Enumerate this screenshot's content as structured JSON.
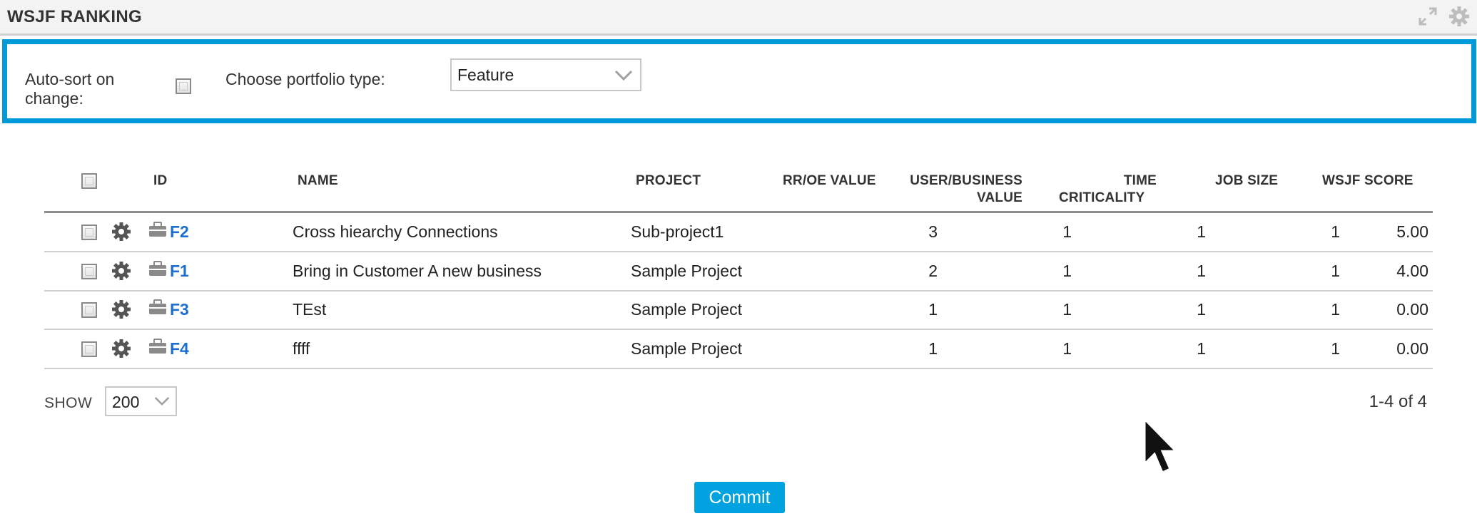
{
  "header": {
    "title": "WSJF RANKING",
    "icons": [
      "expand-icon",
      "gear-icon"
    ]
  },
  "filters": {
    "autosort_label": "Auto-sort on change:",
    "autosort_checked": false,
    "portfolio_label": "Choose portfolio type:",
    "portfolio_value": "Feature"
  },
  "table": {
    "columns": {
      "id": "ID",
      "name": "NAME",
      "project": "PROJECT",
      "rroe": "RR/OE VALUE",
      "ubv1": "USER/BUSINESS",
      "ubv2": "VALUE",
      "tc1": "TIME",
      "tc2": "CRITICALITY",
      "job_size": "JOB SIZE",
      "wsjf": "WSJF SCORE"
    },
    "rows": [
      {
        "id": "F2",
        "name": "Cross hiearchy Connections",
        "project": "Sub-project1",
        "rroe": "3",
        "ubv": "1",
        "tc": "1",
        "job_size": "1",
        "wsjf": "5.00"
      },
      {
        "id": "F1",
        "name": "Bring in Customer A new business",
        "project": "Sample Project",
        "rroe": "2",
        "ubv": "1",
        "tc": "1",
        "job_size": "1",
        "wsjf": "4.00"
      },
      {
        "id": "F3",
        "name": "TEst",
        "project": "Sample Project",
        "rroe": "1",
        "ubv": "1",
        "tc": "1",
        "job_size": "1",
        "wsjf": "0.00"
      },
      {
        "id": "F4",
        "name": "ffff",
        "project": "Sample Project",
        "rroe": "1",
        "ubv": "1",
        "tc": "1",
        "job_size": "1",
        "wsjf": "0.00"
      }
    ]
  },
  "pagination": {
    "show_label": "SHOW",
    "page_size": "200",
    "range_text": "1-4 of 4"
  },
  "actions": {
    "commit_label": "Commit"
  },
  "colors": {
    "accent": "#009ad8",
    "button": "#00a3e0",
    "link": "#1d6fd0"
  }
}
